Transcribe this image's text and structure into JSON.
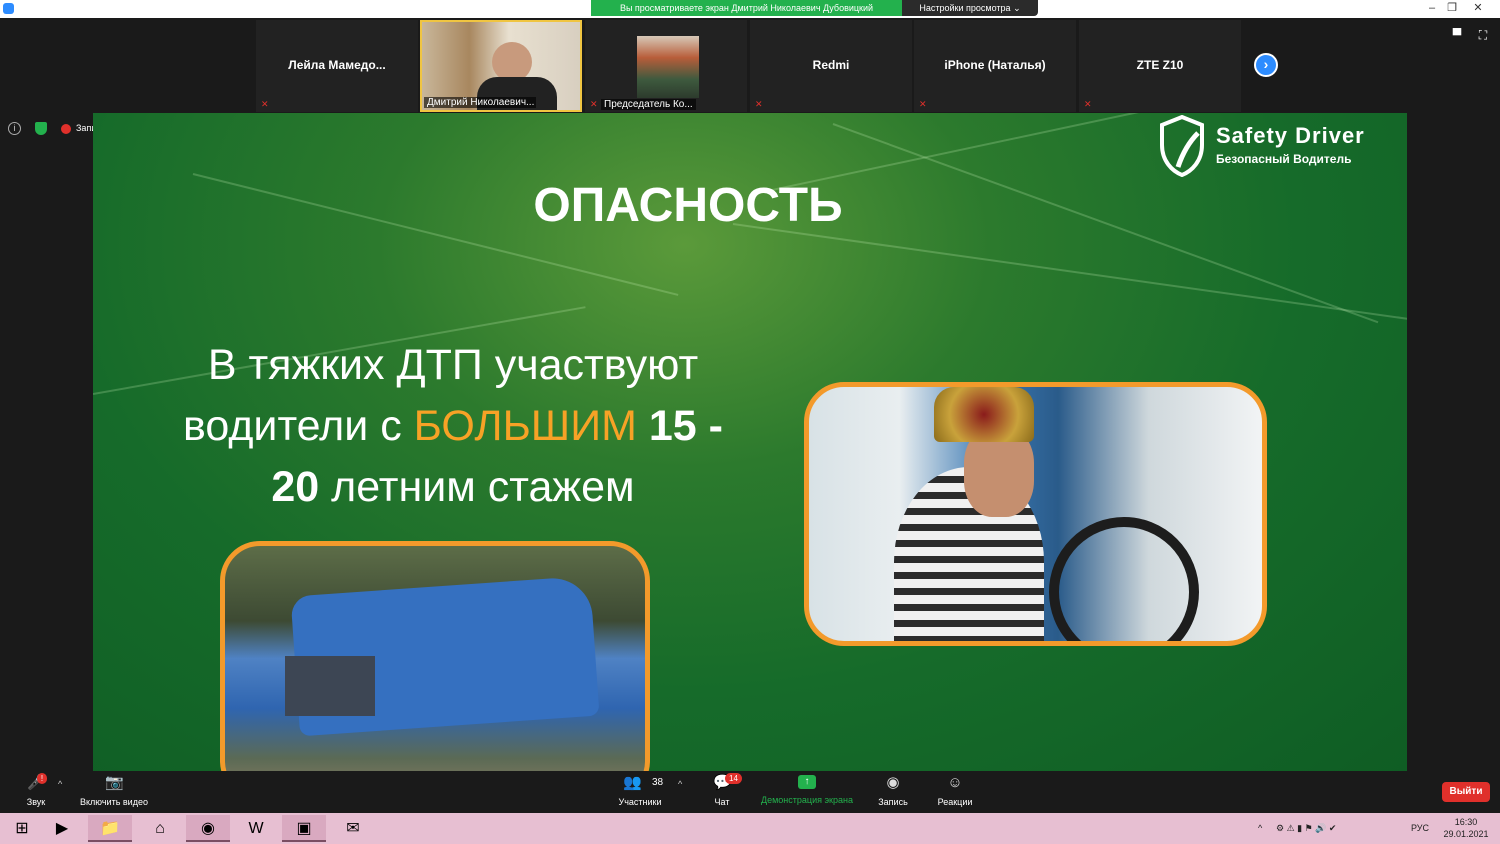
{
  "titlebar": {
    "share_banner": "Вы просматриваете экран Дмитрий Николаевич Дубовицкий",
    "view_options": "Настройки просмотра",
    "minimize": "–",
    "restore": "❐",
    "close": "✕"
  },
  "participants": [
    {
      "name": "Лейла  Мамедо..."
    },
    {
      "label": "Дмитрий Николаевич..."
    },
    {
      "label": "Председатель Ко..."
    },
    {
      "name": "Redmi"
    },
    {
      "name": "iPhone (Наталья)"
    },
    {
      "name": "ZTE Z10"
    }
  ],
  "status": {
    "info": "i",
    "recording": "Запись"
  },
  "slide": {
    "logo_title": "Safety Driver",
    "logo_subtitle": "Безопасный Водитель",
    "title": "ОПАСНОСТЬ",
    "line1": "В тяжких ДТП участвуют",
    "line2_a": "водители с ",
    "line2_highlight": "БОЛЬШИМ",
    "line2_num": " 15 -",
    "line3_num": "20",
    "line3_b": " летним стажем"
  },
  "toolbar": {
    "audio": "Звук",
    "video": "Включить видео",
    "participants": "Участники",
    "participants_count": "38",
    "chat": "Чат",
    "chat_badge": "14",
    "share": "Демонстрация экрана",
    "record": "Запись",
    "reactions": "Реакции",
    "leave": "Выйти",
    "audio_alert": "!"
  },
  "taskbar": {
    "language": "РУС",
    "time": "16:30",
    "date": "29.01.2021"
  },
  "colors": {
    "zoom_blue": "#2d8cff",
    "share_green": "#23b14d",
    "slide_green": "#166b2a",
    "highlight_orange": "#f7a226",
    "leave_red": "#e0302b"
  }
}
